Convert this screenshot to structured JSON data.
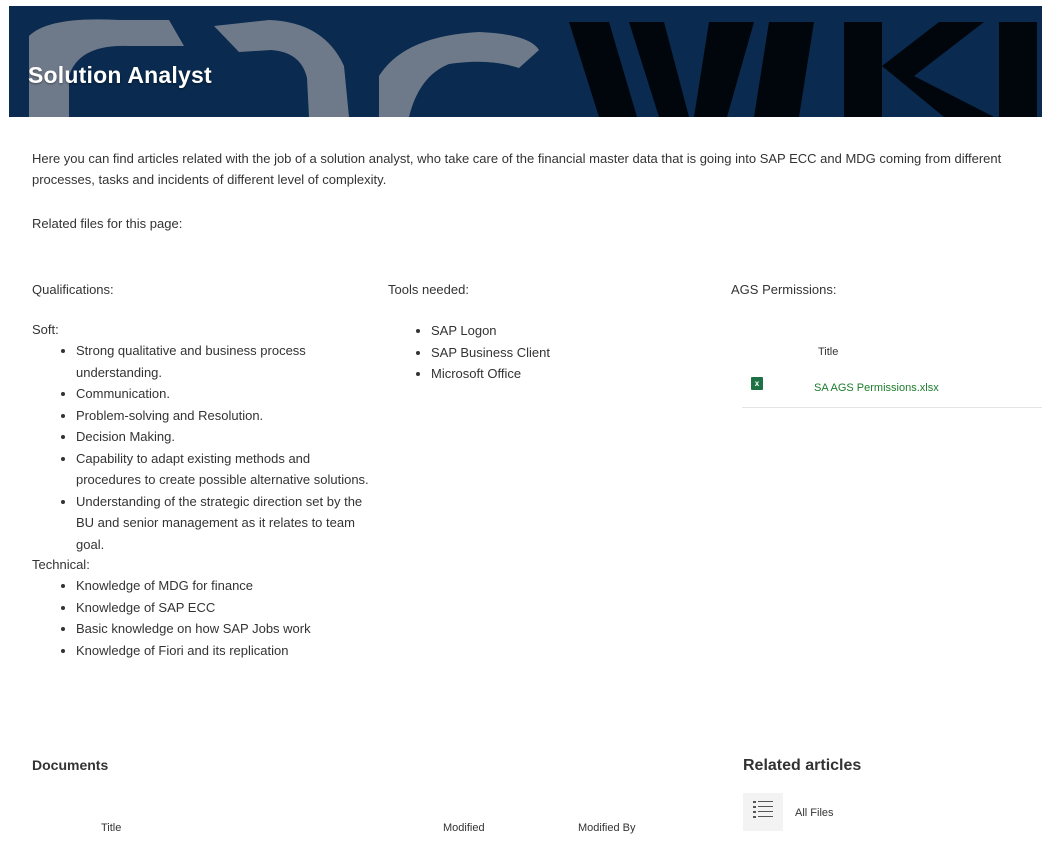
{
  "header": {
    "title": "Solution Analyst",
    "banner_watermark": "CDS WIKI"
  },
  "intro": "Here you can find articles related with the job of a solution analyst, who take care of the financial master data that is going into SAP ECC and MDG coming from different processes, tasks and incidents of different level of complexity.",
  "related_files_label": "Related files for this page:",
  "qualifications": {
    "heading": "Qualifications:",
    "soft_label": "Soft:",
    "soft": [
      "Strong qualitative and business process understanding.",
      "Communication.",
      "Problem-solving and Resolution.",
      "Decision Making.",
      "Capability to adapt existing methods and procedures to create possible alternative solutions.",
      "Understanding of the strategic direction set by the BU and senior management as it relates to team goal."
    ],
    "technical_label": "Technical:",
    "technical": [
      "Knowledge of MDG for finance",
      "Knowledge of SAP ECC",
      "Basic knowledge on how SAP Jobs work",
      "Knowledge of Fiori and its replication"
    ]
  },
  "tools": {
    "heading": "Tools needed:",
    "items": [
      "SAP Logon",
      "SAP Business Client",
      "Microsoft Office"
    ]
  },
  "ags": {
    "heading": "AGS Permissions:",
    "column_title": "Title",
    "files": [
      {
        "name": "SA AGS Permissions.xlsx",
        "icon": "excel-file-icon"
      }
    ]
  },
  "documents": {
    "heading": "Documents",
    "columns": [
      "Title",
      "Modified",
      "Modified By"
    ]
  },
  "related_articles": {
    "heading": "Related articles",
    "items": [
      {
        "label": "All Files",
        "icon": "list-icon"
      }
    ]
  },
  "colors": {
    "banner_bg": "#0a2a4e",
    "link": "#1c7c2c",
    "excel": "#1e7145"
  }
}
